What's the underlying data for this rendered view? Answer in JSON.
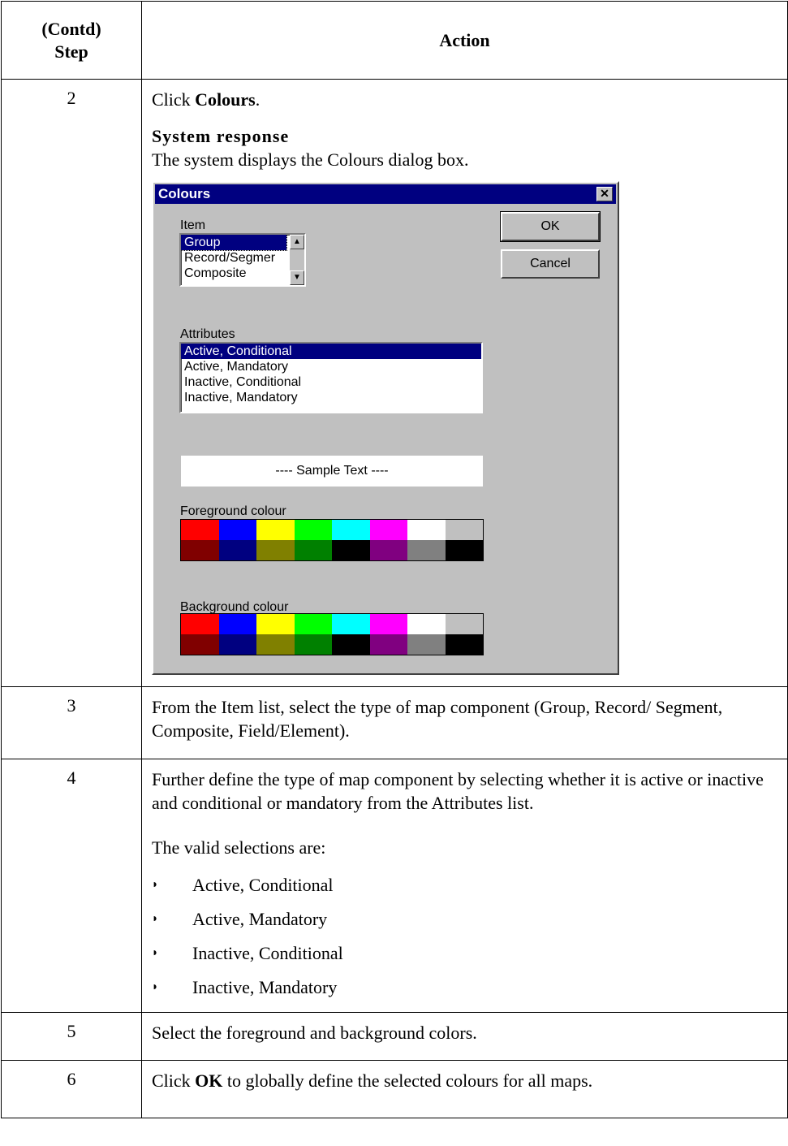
{
  "header": {
    "step_line1": "(Contd)",
    "step_line2": "Step",
    "action": "Action"
  },
  "rows": [
    {
      "step": "2",
      "pre": "Click ",
      "bold": "Colours",
      "post": ".",
      "response_label": "System response",
      "response_text": "The system displays the Colours dialog box."
    },
    {
      "step": "3",
      "text": "From the Item list, select the type of map component (Group, Record/ Segment, Composite, Field/Element)."
    },
    {
      "step": "4",
      "text": "Further define the type of map component by selecting whether it is active or inactive and conditional or mandatory from the Attributes list.",
      "text2": "The valid selections are:",
      "bullets": [
        "Active, Conditional",
        "Active, Mandatory",
        "Inactive, Conditional",
        "Inactive, Mandatory"
      ]
    },
    {
      "step": "5",
      "text": "Select the foreground and background colors."
    },
    {
      "step": "6",
      "pre": "Click ",
      "bold": "OK",
      "post": " to globally define the selected colours for all maps."
    }
  ],
  "dialog": {
    "title": "Colours",
    "item_label": "Item",
    "items": [
      "Group",
      "Record/Segmer",
      "Composite"
    ],
    "ok": "OK",
    "cancel": "Cancel",
    "attributes_label": "Attributes",
    "attributes": [
      "Active, Conditional",
      "Active, Mandatory",
      "Inactive, Conditional",
      "Inactive, Mandatory"
    ],
    "sample_text": "---- Sample Text ----",
    "foreground_label": "Foreground colour",
    "background_label": "Background colour",
    "palette_top": [
      "#ff0000",
      "#0000ff",
      "#ffff00",
      "#00ff00",
      "#00ffff",
      "#ff00ff",
      "#ffffff",
      "#c0c0c0"
    ],
    "palette_bottom": [
      "#800000",
      "#000080",
      "#808000",
      "#008000",
      "#000000",
      "#800080",
      "#808080",
      "#000000"
    ]
  }
}
